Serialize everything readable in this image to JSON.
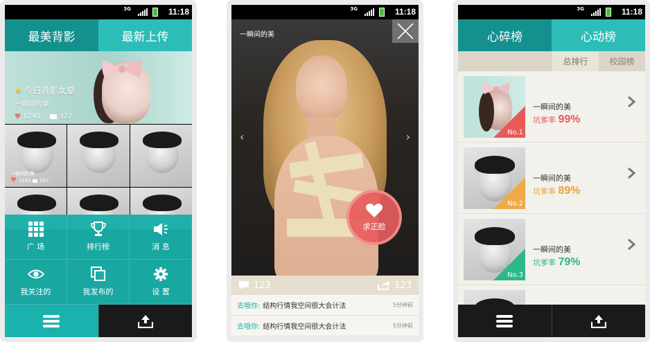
{
  "status_bar": {
    "network": "3G",
    "time": "11:18"
  },
  "screen1": {
    "tabs": [
      "最美背影",
      "最新上传"
    ],
    "hero": {
      "title": "今日背影女皇",
      "user": "一瞬间的美",
      "likes": "1245",
      "comments": "327"
    },
    "thumb": {
      "user": "一瞬间的美",
      "likes": "1245",
      "comments": "327"
    },
    "menu": [
      {
        "label": "广 场",
        "icon": "grid-icon"
      },
      {
        "label": "排行榜",
        "icon": "trophy-icon"
      },
      {
        "label": "消 息",
        "icon": "speaker-icon"
      },
      {
        "label": "我关注的",
        "icon": "eye-icon"
      },
      {
        "label": "我发布的",
        "icon": "copy-icon"
      },
      {
        "label": "设 置",
        "icon": "gear-icon"
      }
    ]
  },
  "screen2": {
    "title": "一瞬间的美",
    "like_label": "求正脸",
    "comment_count": "123",
    "share_count": "123",
    "comments": [
      {
        "user": "去哦你:",
        "text": "结构行情我空间很大会计法",
        "time": "5分钟前"
      },
      {
        "user": "去哦你:",
        "text": "结构行情我空间很大会计法",
        "time": "5分钟前"
      }
    ]
  },
  "screen3": {
    "tabs": [
      "心碎榜",
      "心动榜"
    ],
    "subtabs": [
      "总排行",
      "校园榜"
    ],
    "rate_label": "坑爹率",
    "ranks": [
      {
        "rank": "No.1",
        "name": "一瞬间的美",
        "rate": "99%",
        "color": "#e85a5a"
      },
      {
        "rank": "No.2",
        "name": "一瞬间的美",
        "rate": "89%",
        "color": "#e9a23b"
      },
      {
        "rank": "No.3",
        "name": "一瞬间的美",
        "rate": "79%",
        "color": "#2bb98a"
      }
    ]
  }
}
